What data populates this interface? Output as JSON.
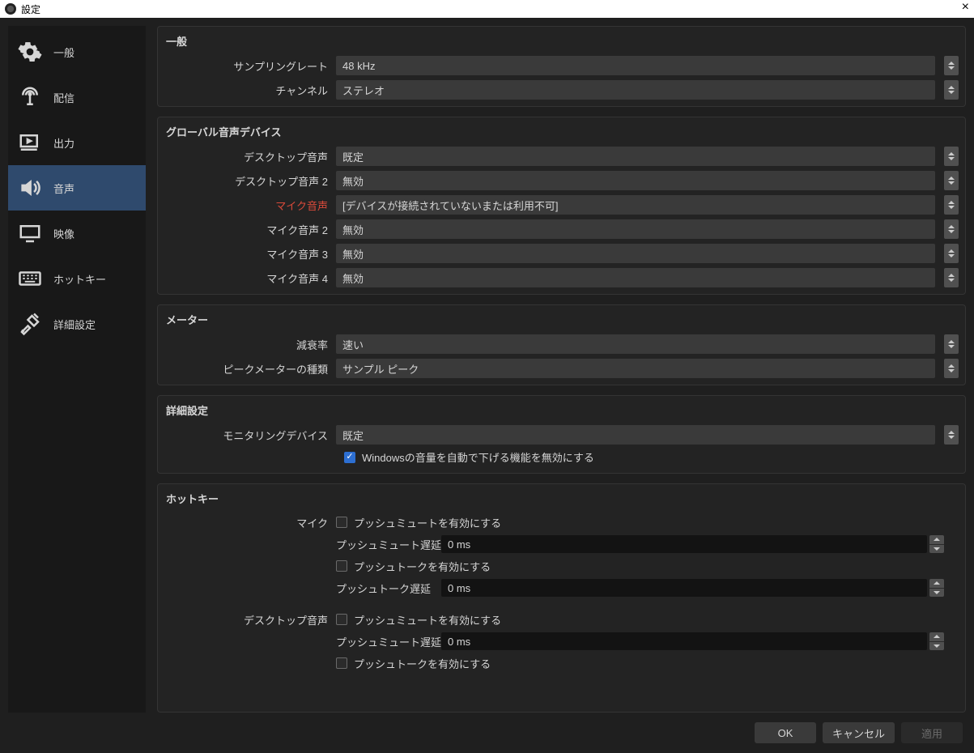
{
  "title": "設定",
  "sidebar": {
    "items": [
      {
        "label": "一般"
      },
      {
        "label": "配信"
      },
      {
        "label": "出力"
      },
      {
        "label": "音声"
      },
      {
        "label": "映像"
      },
      {
        "label": "ホットキー"
      },
      {
        "label": "詳細設定"
      }
    ]
  },
  "sections": {
    "general": {
      "title": "一般",
      "sampling_rate": {
        "label": "サンプリングレート",
        "value": "48 kHz"
      },
      "channel": {
        "label": "チャンネル",
        "value": "ステレオ"
      }
    },
    "global_audio": {
      "title": "グローバル音声デバイス",
      "desktop1": {
        "label": "デスクトップ音声",
        "value": "既定"
      },
      "desktop2": {
        "label": "デスクトップ音声 2",
        "value": "無効"
      },
      "mic1": {
        "label": "マイク音声",
        "value": "[デバイスが接続されていないまたは利用不可]"
      },
      "mic2": {
        "label": "マイク音声 2",
        "value": "無効"
      },
      "mic3": {
        "label": "マイク音声 3",
        "value": "無効"
      },
      "mic4": {
        "label": "マイク音声 4",
        "value": "無効"
      }
    },
    "meter": {
      "title": "メーター",
      "decay": {
        "label": "減衰率",
        "value": "速い"
      },
      "peak": {
        "label": "ピークメーターの種類",
        "value": "サンプル ピーク"
      }
    },
    "advanced": {
      "title": "詳細設定",
      "monitoring": {
        "label": "モニタリングデバイス",
        "value": "既定"
      },
      "ducking": {
        "label": "Windowsの音量を自動で下げる機能を無効にする"
      }
    },
    "hotkeys": {
      "title": "ホットキー",
      "mic": {
        "label": "マイク",
        "push_mute_enable": "プッシュミュートを有効にする",
        "push_mute_delay_label": "プッシュミュート遅延",
        "push_mute_delay_value": "0 ms",
        "push_talk_enable": "プッシュトークを有効にする",
        "push_talk_delay_label": "プッシュトーク遅延",
        "push_talk_delay_value": "0 ms"
      },
      "desktop": {
        "label": "デスクトップ音声",
        "push_mute_enable": "プッシュミュートを有効にする",
        "push_mute_delay_label": "プッシュミュート遅延",
        "push_mute_delay_value": "0 ms",
        "push_talk_enable": "プッシュトークを有効にする"
      }
    }
  },
  "buttons": {
    "ok": "OK",
    "cancel": "キャンセル",
    "apply": "適用"
  }
}
